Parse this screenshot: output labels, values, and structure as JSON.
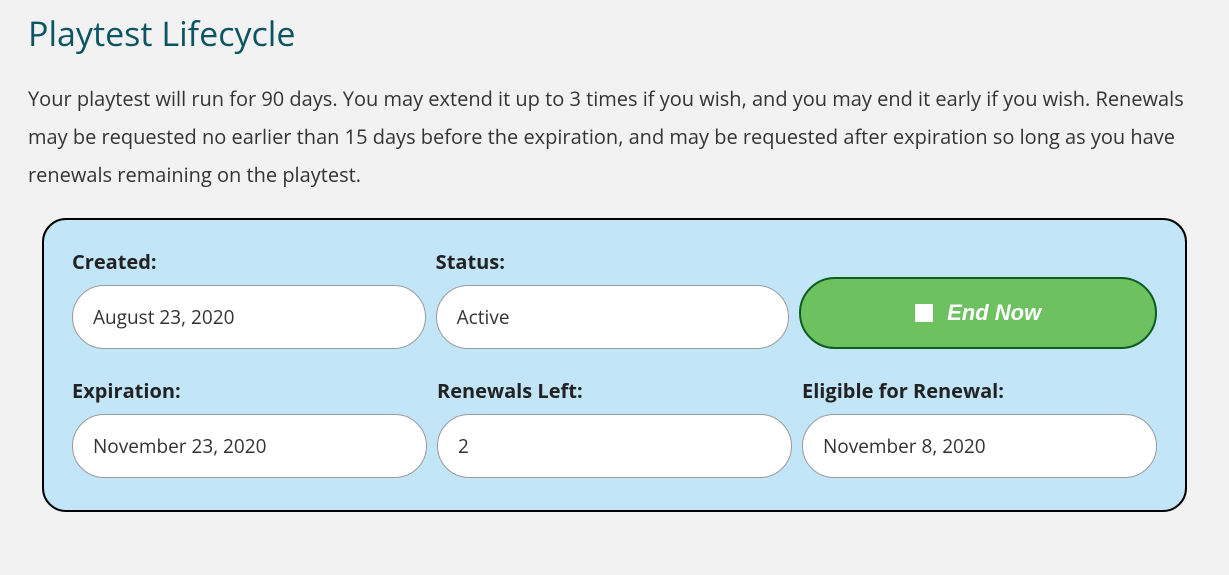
{
  "header": {
    "title": "Playtest Lifecycle",
    "description": "Your playtest will run for 90 days. You may extend it up to 3 times if you wish, and you may end it early if you wish. Renewals may be requested no earlier than 15 days before the expiration, and may be requested after expiration so long as you have renewals remaining on the playtest."
  },
  "lifecycle": {
    "created_label": "Created:",
    "created_value": "August 23, 2020",
    "status_label": "Status:",
    "status_value": "Active",
    "endnow_label": "End Now",
    "expiration_label": "Expiration:",
    "expiration_value": "November 23, 2020",
    "renewals_left_label": "Renewals Left:",
    "renewals_left_value": "2",
    "eligible_label": "Eligible for Renewal:",
    "eligible_value": "November 8, 2020"
  }
}
